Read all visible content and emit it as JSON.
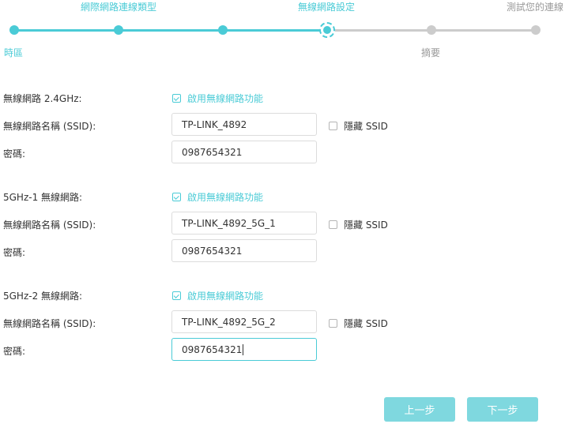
{
  "stepper": {
    "steps_top": [
      "網際網路連線類型",
      "無線網路設定",
      "測試您的連線"
    ],
    "steps_bottom": [
      "時區",
      "摘要"
    ]
  },
  "sections": [
    {
      "band_label": "無線網路 2.4GHz:",
      "enable_label": "啟用無線網路功能",
      "enabled": true,
      "ssid_label": "無線網路名稱 (SSID):",
      "ssid_value": "TP-LINK_4892",
      "hide_label": "隱藏 SSID",
      "hide_checked": false,
      "password_label": "密碼:",
      "password_value": "0987654321"
    },
    {
      "band_label": "5GHz-1 無線網路:",
      "enable_label": "啟用無線網路功能",
      "enabled": true,
      "ssid_label": "無線網路名稱 (SSID):",
      "ssid_value": "TP-LINK_4892_5G_1",
      "hide_label": "隱藏 SSID",
      "hide_checked": false,
      "password_label": "密碼:",
      "password_value": "0987654321"
    },
    {
      "band_label": "5GHz-2 無線網路:",
      "enable_label": "啟用無線網路功能",
      "enabled": true,
      "ssid_label": "無線網路名稱 (SSID):",
      "ssid_value": "TP-LINK_4892_5G_2",
      "hide_label": "隱藏 SSID",
      "hide_checked": false,
      "password_label": "密碼:",
      "password_value": "0987654321"
    }
  ],
  "buttons": {
    "prev": "上一步",
    "next": "下一步"
  },
  "colors": {
    "accent": "#4acbd6",
    "button": "#7fd8df",
    "inactive": "#cccccc"
  }
}
